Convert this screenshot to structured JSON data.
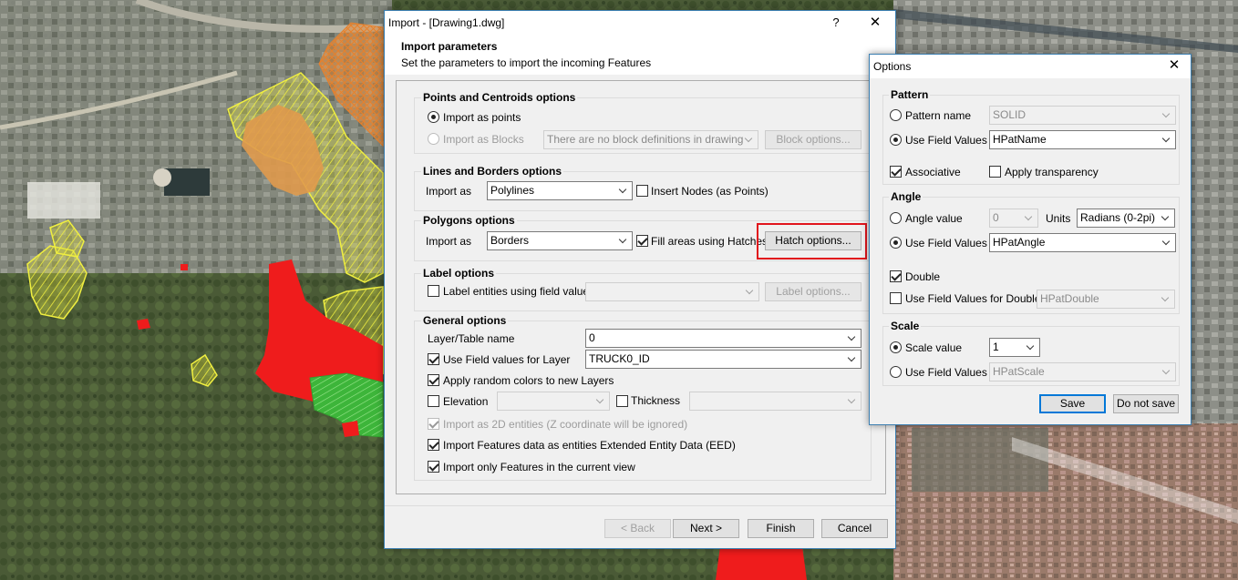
{
  "import_dialog": {
    "title": "Import - [Drawing1.dwg]",
    "help_glyph": "?",
    "close_glyph": "✕",
    "header_title": "Import parameters",
    "header_subtitle": "Set the parameters to import the incoming Features",
    "points": {
      "title": "Points and Centroids options",
      "import_as_points": "Import as points",
      "import_as_blocks": "Import as Blocks",
      "block_select_value": "There are no block definitions in drawing",
      "block_options_button": "Block options..."
    },
    "lines": {
      "title": "Lines and Borders options",
      "import_as_label": "Import as",
      "import_as_value": "Polylines",
      "insert_nodes": "Insert Nodes (as Points)"
    },
    "polygons": {
      "title": "Polygons options",
      "import_as_label": "Import as",
      "import_as_value": "Borders",
      "fill_areas": "Fill areas using Hatches",
      "hatch_options_button": "Hatch options..."
    },
    "label": {
      "title": "Label options",
      "label_entities": "Label entities using field value",
      "label_options_button": "Label options..."
    },
    "general": {
      "title": "General options",
      "layer_table_label": "Layer/Table name",
      "layer_table_value": "0",
      "use_field_values_layer": "Use Field values for Layer",
      "layer_field_value": "TRUCK0_ID",
      "apply_random_colors": "Apply random colors to new Layers",
      "elevation": "Elevation",
      "thickness": "Thickness",
      "import_2d": "Import as 2D entities (Z coordinate will be ignored)",
      "import_eed": "Import Features data as entities Extended Entity Data (EED)",
      "import_current_view": "Import only Features in the current view"
    },
    "footer": {
      "back": "< Back",
      "next": "Next >",
      "finish": "Finish",
      "cancel": "Cancel"
    }
  },
  "options_dialog": {
    "title": "Options",
    "close_glyph": "✕",
    "pattern": {
      "title": "Pattern",
      "pattern_name_label": "Pattern name",
      "pattern_name_value": "SOLID",
      "use_field_values_label": "Use Field Values",
      "use_field_values_value": "HPatName",
      "associative": "Associative",
      "apply_transparency": "Apply transparency"
    },
    "angle": {
      "title": "Angle",
      "angle_value_label": "Angle value",
      "angle_value": "0",
      "units_label": "Units",
      "units_value": "Radians (0-2pi)",
      "use_field_values_label": "Use Field Values",
      "use_field_values_value": "HPatAngle",
      "double": "Double",
      "use_field_values_double_label": "Use Field Values for Double",
      "use_field_values_double_value": "HPatDouble"
    },
    "scale": {
      "title": "Scale",
      "scale_value_label": "Scale value",
      "scale_value": "1",
      "use_field_values_label": "Use Field Values",
      "use_field_values_value": "HPatScale"
    },
    "save_button": "Save",
    "dont_save_button": "Do not save"
  },
  "colors": {
    "highlight": "#e1141c",
    "dialog_border": "#3c7fb1",
    "default_button": "#0078d7"
  }
}
